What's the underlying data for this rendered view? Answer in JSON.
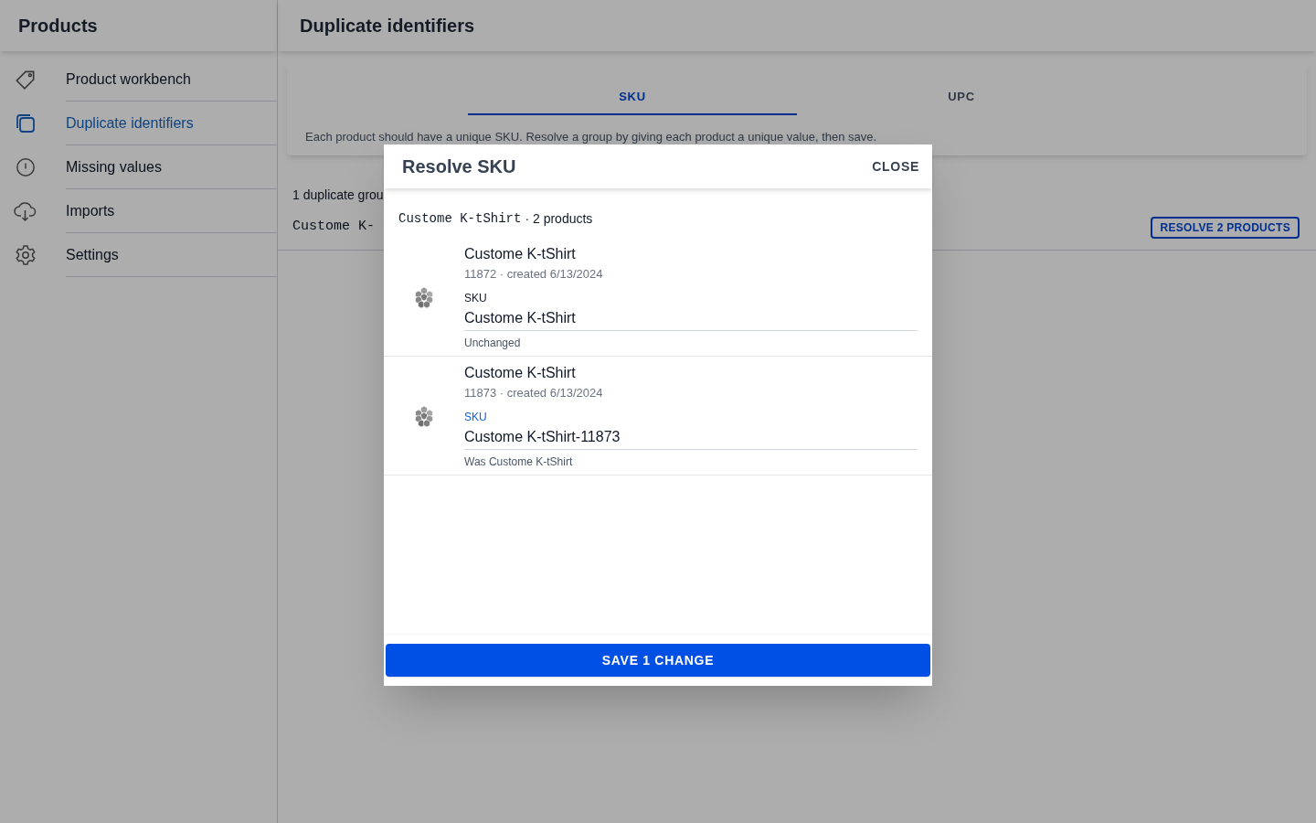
{
  "sidebar": {
    "title": "Products",
    "items": [
      {
        "label": "Product workbench",
        "selected": false
      },
      {
        "label": "Duplicate identifiers",
        "selected": true
      },
      {
        "label": "Missing values",
        "selected": false
      },
      {
        "label": "Imports",
        "selected": false
      },
      {
        "label": "Settings",
        "selected": false
      }
    ]
  },
  "header": {
    "title": "Duplicate identifiers"
  },
  "tabs": [
    {
      "label": "SKU",
      "selected": true
    },
    {
      "label": "UPC",
      "selected": false
    }
  ],
  "description": "Each product should have a unique SKU. Resolve a group by giving each product a unique value, then save.",
  "summary": "1 duplicate grou",
  "group": {
    "name": "Custome K-",
    "button": "RESOLVE 2 PRODUCTS"
  },
  "dialog": {
    "title": "Resolve SKU",
    "close": "CLOSE",
    "group_name": "Custome K-tShirt",
    "group_count": "· 2 products",
    "products": [
      {
        "name": "Custome K-tShirt",
        "meta": "11872 · created 6/13/2024",
        "field_label": "SKU",
        "value": "Custome K-tShirt",
        "note": "Unchanged",
        "changed": false
      },
      {
        "name": "Custome K-tShirt",
        "meta": "11873 · created 6/13/2024",
        "field_label": "SKU",
        "value": "Custome K-tShirt-11873",
        "note": "Was Custome K-tShirt",
        "changed": true
      }
    ],
    "save": "SAVE 1 CHANGE"
  }
}
